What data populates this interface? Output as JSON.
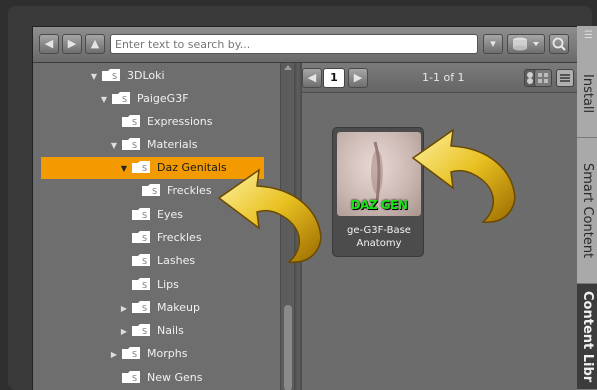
{
  "toolbar": {
    "back_icon": "back-arrow-icon",
    "forward_icon": "forward-arrow-icon",
    "up_icon": "up-arrow-icon",
    "search_placeholder": "Enter text to search by...",
    "filter_icon": "filter-dropdown-icon",
    "database_icon": "database-icon",
    "zoom_icon": "search-icon"
  },
  "tree": {
    "items": [
      {
        "label": "3DLoki",
        "expanded": true
      },
      {
        "label": "PaigeG3F",
        "expanded": true
      },
      {
        "label": "Expressions",
        "expanded": false
      },
      {
        "label": "Materials",
        "expanded": true
      },
      {
        "label": "Daz Genitals",
        "expanded": true,
        "selected": true
      },
      {
        "label": "Freckles"
      },
      {
        "label": "Eyes"
      },
      {
        "label": "Freckles"
      },
      {
        "label": "Lashes"
      },
      {
        "label": "Lips"
      },
      {
        "label": "Makeup",
        "expanded": false
      },
      {
        "label": "Nails",
        "expanded": false
      },
      {
        "label": "Morphs",
        "expanded": false
      },
      {
        "label": "New Gens"
      }
    ]
  },
  "content": {
    "page": "1",
    "range": "1-1 of 1",
    "item": {
      "overlay": "DAZ GEN",
      "label": "ge-G3F-Base Anatomy"
    }
  },
  "side_tabs": {
    "install": "Install",
    "smart_content": "Smart Content",
    "content_library": "Content Libr"
  },
  "colors": {
    "selection": "#f39a00",
    "overlay_arrow": "#e8c020",
    "overlay_text": "#19e619"
  }
}
